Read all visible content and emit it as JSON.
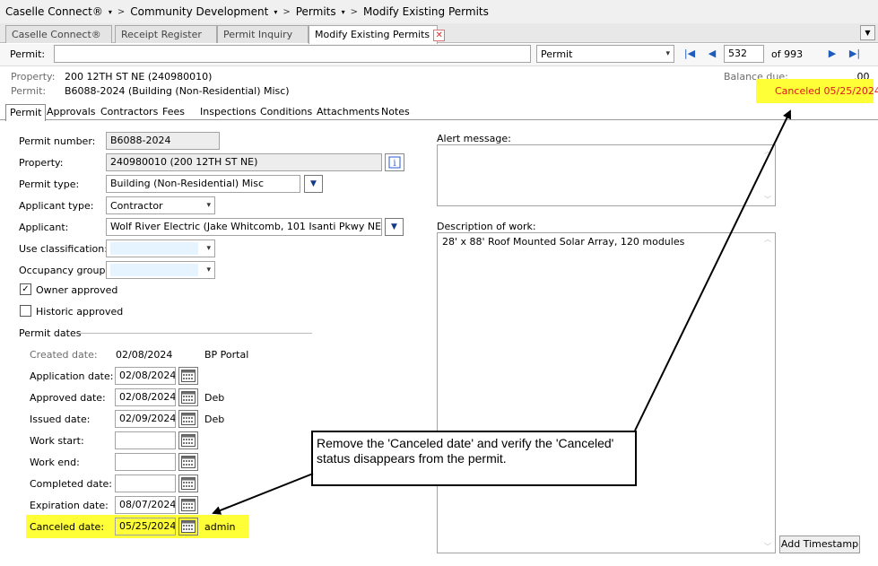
{
  "breadcrumb": {
    "items": [
      "Caselle Connect®",
      "Community Development",
      "Permits",
      "Modify Existing Permits"
    ],
    "separator": ">"
  },
  "window_tabs": [
    "Caselle Connect®",
    "Receipt Register",
    "Permit Inquiry",
    "Modify Existing Permits"
  ],
  "toolbar": {
    "permit_label": "Permit:",
    "permit_value": "",
    "type_select": "Permit",
    "record_number": "532",
    "record_total": "of 993"
  },
  "summary": {
    "property_label": "Property:",
    "property_value": "200 12TH ST NE (240980010)",
    "permit_label": "Permit:",
    "permit_value": "B6088-2024 (Building (Non-Residential) Misc)",
    "balance_label": "Balance due:",
    "balance_value": ".00",
    "status": "Canceled 05/25/2024"
  },
  "form_tabs": [
    "Permit",
    "Approvals",
    "Contractors",
    "Fees",
    "Inspections",
    "Conditions",
    "Attachments",
    "Notes"
  ],
  "form": {
    "permit_number": {
      "label": "Permit number:",
      "value": "B6088-2024"
    },
    "property": {
      "label": "Property:",
      "value": "240980010 (200 12TH ST NE)"
    },
    "permit_type": {
      "label": "Permit type:",
      "value": "Building (Non-Residential) Misc"
    },
    "applicant_type": {
      "label": "Applicant type:",
      "value": "Contractor"
    },
    "applicant": {
      "label": "Applicant:",
      "value": "Wolf River Electric (Jake Whitcomb, 101 Isanti Pkwy NE)"
    },
    "use_classification": {
      "label": "Use classification:",
      "value": ""
    },
    "occupancy_group": {
      "label": "Occupancy group:",
      "value": ""
    },
    "owner_approved": {
      "label": "Owner approved",
      "checked": true
    },
    "historic_approved": {
      "label": "Historic approved",
      "checked": false
    }
  },
  "permit_dates": {
    "header": "Permit dates",
    "created": {
      "label": "Created date:",
      "value": "02/08/2024",
      "by": "BP Portal"
    },
    "application": {
      "label": "Application date:",
      "value": "02/08/2024",
      "by": ""
    },
    "approved": {
      "label": "Approved date:",
      "value": "02/08/2024",
      "by": "Deb"
    },
    "issued": {
      "label": "Issued date:",
      "value": "02/09/2024",
      "by": "Deb"
    },
    "work_start": {
      "label": "Work start:",
      "value": ""
    },
    "work_end": {
      "label": "Work end:",
      "value": ""
    },
    "completed": {
      "label": "Completed date:",
      "value": ""
    },
    "expiration": {
      "label": "Expiration date:",
      "value": "08/07/2024"
    },
    "canceled": {
      "label": "Canceled date:",
      "value": "05/25/2024",
      "by": "admin"
    }
  },
  "alert": {
    "label": "Alert message:",
    "value": ""
  },
  "description": {
    "label": "Description of work:",
    "value": "28' x 88' Roof Mounted Solar Array, 120 modules"
  },
  "add_timestamp_label": "Add Timestamp",
  "callout_text": "Remove the 'Canceled date' and verify the 'Canceled' status disappears from the permit.",
  "colors": {
    "highlight": "#ffff38",
    "status_red": "#e0161b",
    "nav_blue": "#1e5bbf"
  }
}
